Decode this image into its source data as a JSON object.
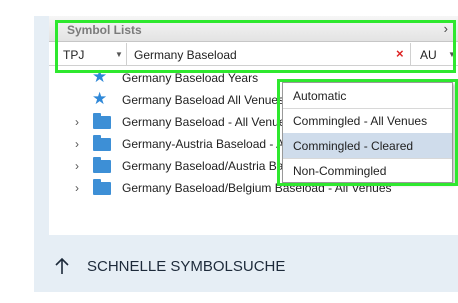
{
  "panel": {
    "title": "Symbol Lists",
    "collapse_icon": "chevron-right-icon"
  },
  "toolbar": {
    "exchange_value": "TPJ",
    "search_value": "Germany Baseload",
    "search_clear_icon": "close-icon",
    "au_value": "AU"
  },
  "list": {
    "items": [
      {
        "label": "Germany Baseload Years",
        "icon": "star-icon",
        "expandable": false
      },
      {
        "label": "Germany Baseload All Venues",
        "icon": "star-icon",
        "expandable": false
      },
      {
        "label": "Germany Baseload - All Venues",
        "icon": "folder-icon",
        "expandable": true
      },
      {
        "label": "Germany-Austria Baseload - All Venues",
        "icon": "folder-icon",
        "expandable": true
      },
      {
        "label": "Germany Baseload/Austria Baseload - All Venues",
        "icon": "folder-icon",
        "expandable": true
      },
      {
        "label": "Germany Baseload/Belgium Baseload - All Venues",
        "icon": "folder-icon",
        "expandable": true
      }
    ]
  },
  "dropdown": {
    "options": [
      {
        "label": "Automatic",
        "selected": false
      },
      {
        "label": "Commingled - All Venues",
        "selected": false
      },
      {
        "label": "Commingled - Cleared",
        "selected": true
      },
      {
        "label": "Non-Commingled",
        "selected": false
      }
    ]
  },
  "footer": {
    "quick_search_label": "SCHNELLE SYMBOLSUCHE",
    "arrow_icon": "arrow-up-icon"
  },
  "colors": {
    "highlight": "#2ee82e",
    "folder": "#3d8fd6",
    "star": "#2f88d8",
    "selected_option_bg": "#cfdceb",
    "card_bg": "#e6eef5",
    "clear_icon": "#dd2222"
  }
}
